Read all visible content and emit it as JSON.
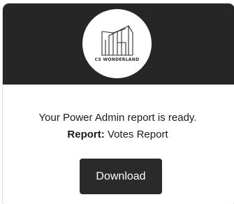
{
  "logo": {
    "name": "CS WONDERLAND",
    "icon": "building-lines-logo-icon"
  },
  "message": {
    "ready_text": "Your Power Admin report is ready.",
    "report_label": "Report:",
    "report_name": "Votes Report"
  },
  "actions": {
    "download_label": "Download"
  },
  "colors": {
    "header_bg": "#262626",
    "button_bg": "#2a2a2a",
    "text": "#1a1a1a",
    "card_border": "#dcdcdc"
  }
}
